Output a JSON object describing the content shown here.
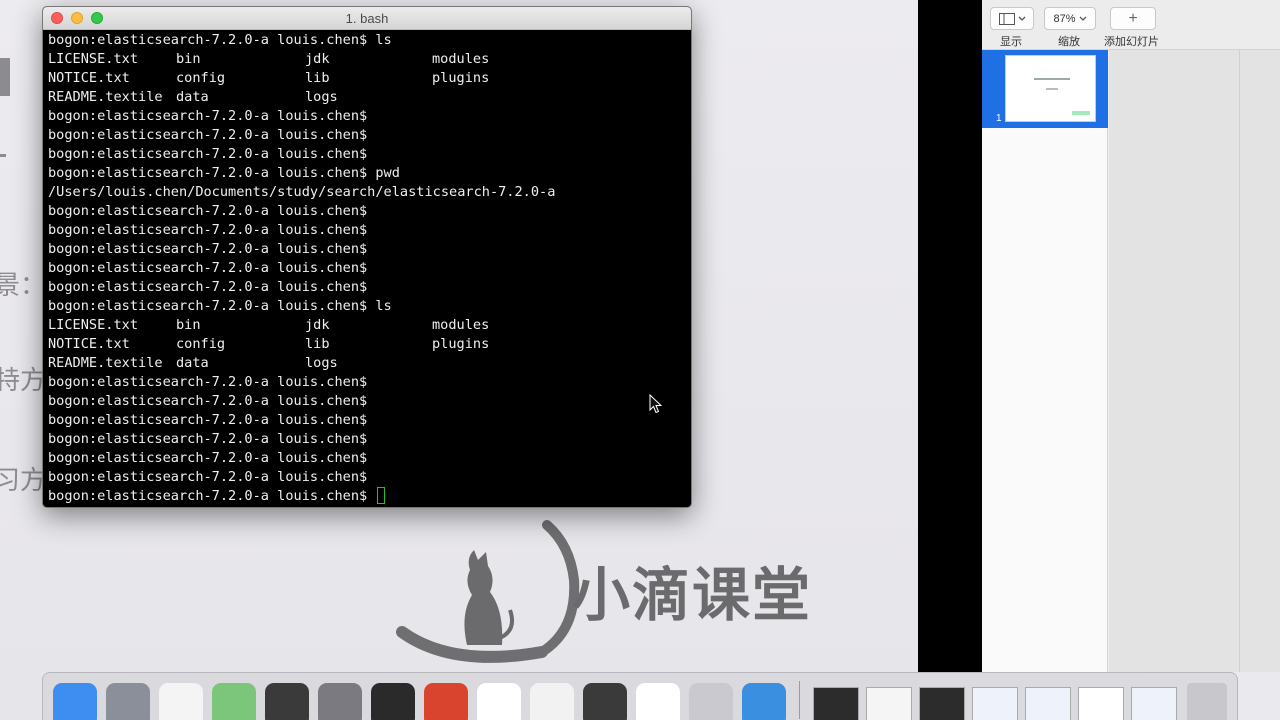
{
  "background_slide": {
    "fragments": [
      "景：",
      "特方",
      "习方"
    ],
    "logo_text": "小滴课堂"
  },
  "terminal": {
    "title": "1. bash",
    "lines": [
      {
        "type": "cmd",
        "text": "bogon:elasticsearch-7.2.0-a louis.chen$ ls"
      },
      {
        "type": "cols",
        "cells": [
          "LICENSE.txt",
          "bin",
          "jdk",
          "modules"
        ]
      },
      {
        "type": "cols",
        "cells": [
          "NOTICE.txt",
          "config",
          "lib",
          "plugins"
        ]
      },
      {
        "type": "cols",
        "cells": [
          "README.textile",
          "data",
          "logs",
          ""
        ]
      },
      {
        "type": "cmd",
        "text": "bogon:elasticsearch-7.2.0-a louis.chen$"
      },
      {
        "type": "cmd",
        "text": "bogon:elasticsearch-7.2.0-a louis.chen$"
      },
      {
        "type": "cmd",
        "text": "bogon:elasticsearch-7.2.0-a louis.chen$"
      },
      {
        "type": "cmd",
        "text": "bogon:elasticsearch-7.2.0-a louis.chen$ pwd"
      },
      {
        "type": "cmd",
        "text": "/Users/louis.chen/Documents/study/search/elasticsearch-7.2.0-a"
      },
      {
        "type": "cmd",
        "text": "bogon:elasticsearch-7.2.0-a louis.chen$"
      },
      {
        "type": "cmd",
        "text": "bogon:elasticsearch-7.2.0-a louis.chen$"
      },
      {
        "type": "cmd",
        "text": "bogon:elasticsearch-7.2.0-a louis.chen$"
      },
      {
        "type": "cmd",
        "text": "bogon:elasticsearch-7.2.0-a louis.chen$"
      },
      {
        "type": "cmd",
        "text": "bogon:elasticsearch-7.2.0-a louis.chen$"
      },
      {
        "type": "cmd",
        "text": "bogon:elasticsearch-7.2.0-a louis.chen$ ls"
      },
      {
        "type": "cols",
        "cells": [
          "LICENSE.txt",
          "bin",
          "jdk",
          "modules"
        ]
      },
      {
        "type": "cols",
        "cells": [
          "NOTICE.txt",
          "config",
          "lib",
          "plugins"
        ]
      },
      {
        "type": "cols",
        "cells": [
          "README.textile",
          "data",
          "logs",
          ""
        ]
      },
      {
        "type": "cmd",
        "text": "bogon:elasticsearch-7.2.0-a louis.chen$"
      },
      {
        "type": "cmd",
        "text": "bogon:elasticsearch-7.2.0-a louis.chen$"
      },
      {
        "type": "cmd",
        "text": "bogon:elasticsearch-7.2.0-a louis.chen$"
      },
      {
        "type": "cmd",
        "text": "bogon:elasticsearch-7.2.0-a louis.chen$"
      },
      {
        "type": "cmd",
        "text": "bogon:elasticsearch-7.2.0-a louis.chen$"
      },
      {
        "type": "cmd",
        "text": "bogon:elasticsearch-7.2.0-a louis.chen$"
      }
    ],
    "prompt_active": "bogon:elasticsearch-7.2.0-a louis.chen$ ",
    "cursor_color": "#22c422"
  },
  "keynote": {
    "view_label": "显示",
    "zoom_value": "87%",
    "zoom_label": "缩放",
    "add_slide_icon": "+",
    "add_slide_label": "添加幻灯片",
    "slide_number": "1",
    "selection_color": "#1f6fe5"
  },
  "dock": {
    "icons": [
      {
        "name": "finder-icon",
        "bg": "#3d8ef0"
      },
      {
        "name": "launchpad-icon",
        "bg": "#8a8f99"
      },
      {
        "name": "reminders-icon",
        "bg": "#f4f4f4"
      },
      {
        "name": "maps-icon",
        "bg": "#7bc67a"
      },
      {
        "name": "sublime-text-icon",
        "bg": "#3a3a3a"
      },
      {
        "name": "system-preferences-icon",
        "bg": "#7a7a80"
      },
      {
        "name": "terminal-icon",
        "bg": "#2a2a2a"
      },
      {
        "name": "paw-icon",
        "bg": "#d9442f"
      },
      {
        "name": "chrome-icon",
        "bg": "#ffffff"
      },
      {
        "name": "textedit-icon",
        "bg": "#f2f2f2"
      },
      {
        "name": "activity-monitor-icon",
        "bg": "#3a3a3a"
      },
      {
        "name": "baidu-netdisk-icon",
        "bg": "#ffffff"
      },
      {
        "name": "filmora-icon",
        "bg": "#c9c9cf"
      },
      {
        "name": "keynote-icon",
        "bg": "#3b8fe0"
      }
    ],
    "documents": [
      {
        "name": "minimized-window-1-icon",
        "bg": "#2c2c2c"
      },
      {
        "name": "minimized-window-2-icon",
        "bg": "#f5f5f5"
      },
      {
        "name": "minimized-window-3-icon",
        "bg": "#2c2c2c"
      },
      {
        "name": "minimized-window-4-icon",
        "bg": "#eef3fb"
      },
      {
        "name": "minimized-window-5-icon",
        "bg": "#eef3fb"
      },
      {
        "name": "minimized-window-6-icon",
        "bg": "#ffffff"
      },
      {
        "name": "minimized-window-7-icon",
        "bg": "#eef3fb"
      }
    ],
    "trash": {
      "name": "trash-icon",
      "bg": "#c8c8cc"
    }
  }
}
